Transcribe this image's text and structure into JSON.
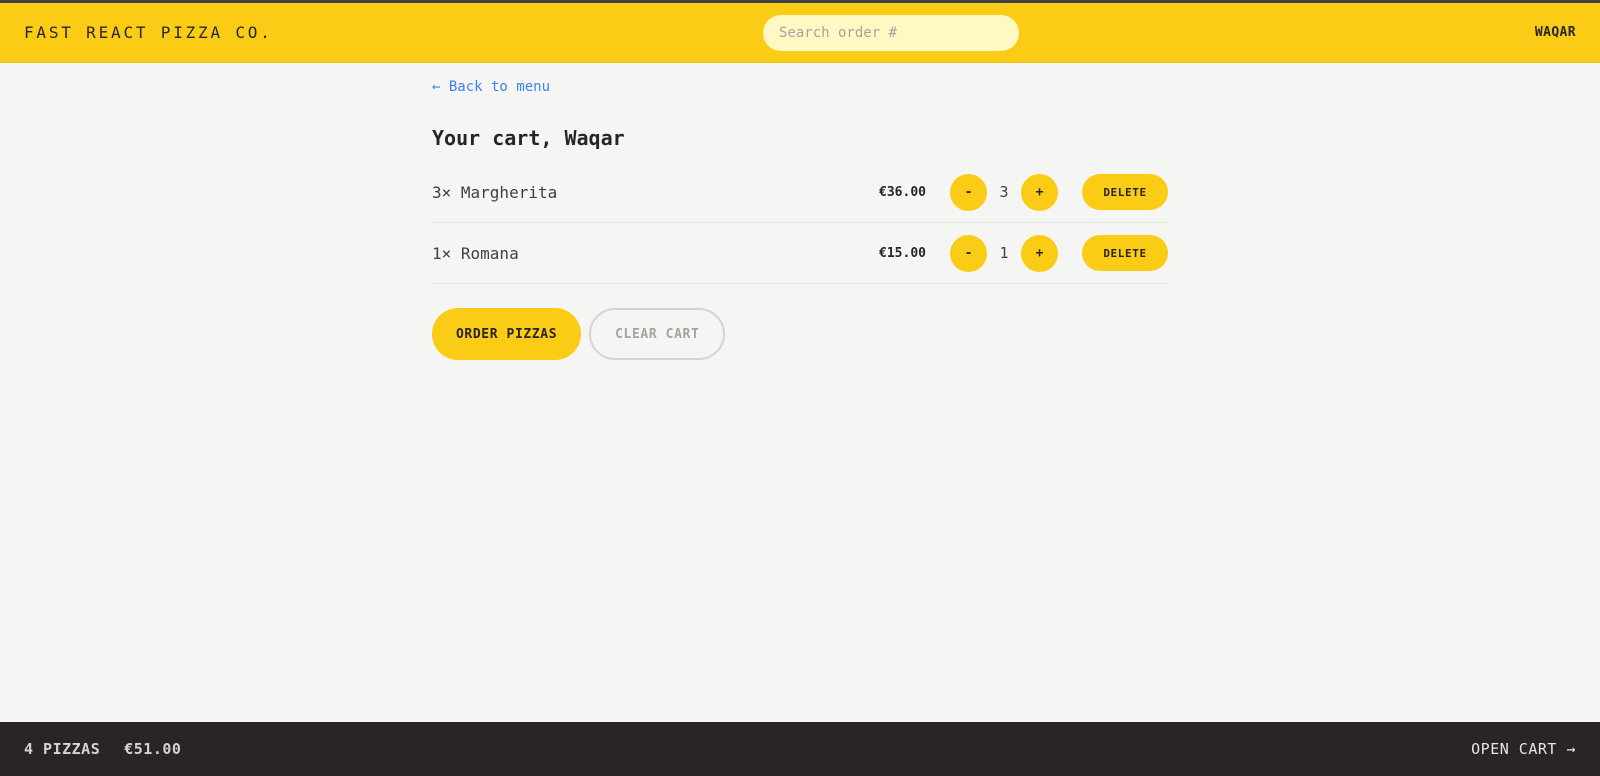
{
  "header": {
    "brand": "FAST REACT PIZZA CO.",
    "search_placeholder": "Search order #",
    "username": "WAQAR"
  },
  "cart": {
    "back_link": "← Back to menu",
    "title": "Your cart, Waqar",
    "items": [
      {
        "name": "3× Margherita",
        "price": "€36.00",
        "quantity": "3"
      },
      {
        "name": "1× Romana",
        "price": "€15.00",
        "quantity": "1"
      }
    ],
    "controls": {
      "decrease": "-",
      "increase": "+",
      "delete": "DELETE"
    },
    "order_button": "ORDER PIZZAS",
    "clear_button": "CLEAR CART"
  },
  "footer": {
    "pizza_count": "4 PIZZAS",
    "total": "€51.00",
    "open_cart": "OPEN CART →"
  },
  "colors": {
    "accent": "#facc15",
    "footer_bg": "#292524",
    "link": "#3b82f6"
  }
}
